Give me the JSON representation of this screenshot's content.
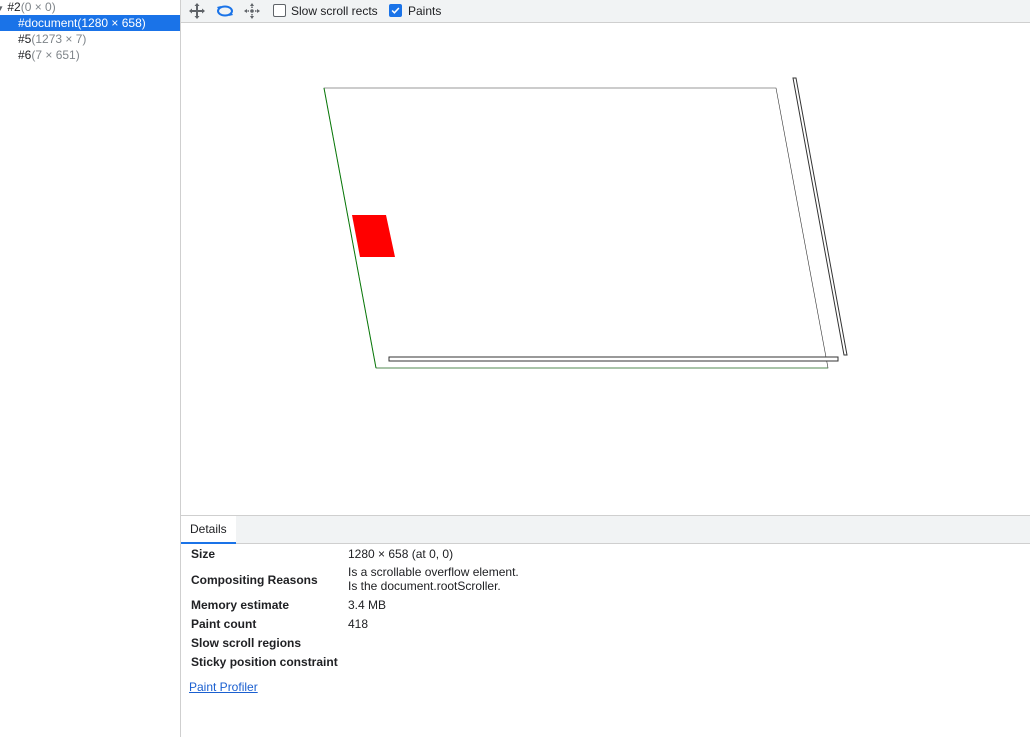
{
  "tree": {
    "items": [
      {
        "id": "#2",
        "dims": "(0 × 0)"
      },
      {
        "id": "#document",
        "dims": "(1280 × 658)"
      },
      {
        "id": "#5",
        "dims": "(1273 × 7)"
      },
      {
        "id": "#6",
        "dims": "(7 × 651)"
      }
    ]
  },
  "toolbar": {
    "icons": [
      "pan-mode-icon",
      "rotate-mode-icon",
      "reset-transform-icon"
    ],
    "slow_scroll_label": "Slow scroll rects",
    "slow_scroll_checked": false,
    "paints_label": "Paints",
    "paints_checked": true
  },
  "colors": {
    "accent": "#1a73e8",
    "paint_rect": "#ff0000",
    "layer_border": "#000000",
    "layer_border_green": "#0a7a0a"
  },
  "details": {
    "tab_label": "Details",
    "rows": [
      {
        "label": "Size",
        "value": "1280 × 658 (at 0, 0)"
      },
      {
        "label": "Compositing Reasons",
        "value_lines": [
          "Is a scrollable overflow element.",
          "Is the document.rootScroller."
        ]
      },
      {
        "label": "Memory estimate",
        "value": "3.4 MB"
      },
      {
        "label": "Paint count",
        "value": "418"
      },
      {
        "label": "Slow scroll regions",
        "value": ""
      },
      {
        "label": "Sticky position constraint",
        "value": ""
      }
    ],
    "link_label": "Paint Profiler"
  }
}
